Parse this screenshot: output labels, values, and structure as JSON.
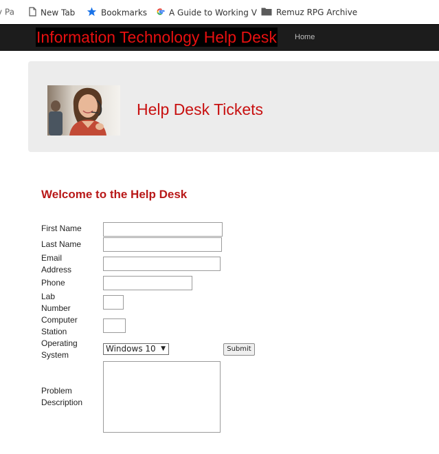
{
  "bookmarks": {
    "cut_item": "y Pa",
    "items": [
      {
        "label": "New Tab",
        "icon": "page-icon"
      },
      {
        "label": "Bookmarks",
        "icon": "star-icon"
      },
      {
        "label": "A Guide to Working V",
        "icon": "google-g-icon"
      },
      {
        "label": "Remuz RPG Archive",
        "icon": "folder-icon"
      }
    ]
  },
  "navbar": {
    "brand": "Information Technology Help Desk",
    "home": "Home"
  },
  "hero": {
    "title": "Help Desk Tickets",
    "image": "support-agent-photo"
  },
  "form": {
    "welcome": "Welcome to the Help Desk",
    "labels": {
      "first_name": "First Name",
      "last_name": "Last Name",
      "email_1": "Email",
      "email_2": "Address",
      "phone": "Phone",
      "lab_1": "Lab",
      "lab_2": "Number",
      "computer_1": "Computer",
      "computer_2": "Station",
      "os_1": "Operating",
      "os_2": "System",
      "problem_1": "Problem",
      "problem_2": "Description"
    },
    "values": {
      "first_name": "",
      "last_name": "",
      "email": "",
      "phone": "",
      "lab_number": "",
      "computer_station": "",
      "problem_description": ""
    },
    "os_selected": "Windows 10",
    "submit": "Submit"
  },
  "colors": {
    "brand_red": "#e81010",
    "heading_red": "#c81010",
    "navbar_bg": "#1c1c1c",
    "hero_bg": "#ececec"
  }
}
